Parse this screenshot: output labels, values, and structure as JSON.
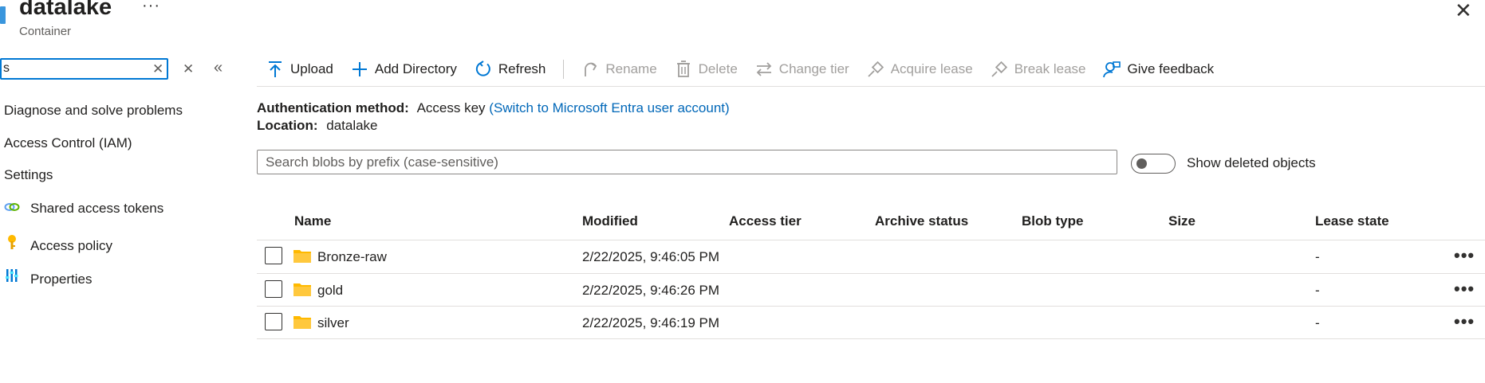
{
  "header": {
    "title": "datalake",
    "subtitle": "Container",
    "more_label": "···",
    "close_label": "✕"
  },
  "nav": {
    "search_value": "s",
    "clear_label": "✕",
    "x_label": "✕",
    "collapse_label": "«",
    "items": [
      {
        "label": "Diagnose and solve problems",
        "icon": ""
      },
      {
        "label": "Access Control (IAM)",
        "icon": ""
      },
      {
        "label": "Settings",
        "icon": ""
      },
      {
        "label": "Shared access tokens",
        "icon": "link-icon"
      },
      {
        "label": "Access policy",
        "icon": "key-icon"
      },
      {
        "label": "Properties",
        "icon": "properties-icon"
      }
    ]
  },
  "toolbar": {
    "upload": "Upload",
    "add_directory": "Add Directory",
    "refresh": "Refresh",
    "rename": "Rename",
    "delete": "Delete",
    "change_tier": "Change tier",
    "acquire_lease": "Acquire lease",
    "break_lease": "Break lease",
    "give_feedback": "Give feedback"
  },
  "info": {
    "auth_label": "Authentication method:",
    "auth_value": "Access key",
    "auth_link": "(Switch to Microsoft Entra user account)",
    "location_label": "Location:",
    "location_value": "datalake"
  },
  "blob_search": {
    "placeholder": "Search blobs by prefix (case-sensitive)",
    "value": ""
  },
  "show_deleted": {
    "label": "Show deleted objects",
    "on": false
  },
  "table": {
    "columns": [
      "Name",
      "Modified",
      "Access tier",
      "Archive status",
      "Blob type",
      "Size",
      "Lease state"
    ],
    "rows": [
      {
        "name": "Bronze-raw",
        "modified": "2/22/2025, 9:46:05 PM",
        "access_tier": "",
        "archive_status": "",
        "blob_type": "",
        "size": "",
        "lease_state": "-",
        "more": "•••"
      },
      {
        "name": "gold",
        "modified": "2/22/2025, 9:46:26 PM",
        "access_tier": "",
        "archive_status": "",
        "blob_type": "",
        "size": "",
        "lease_state": "-",
        "more": "•••"
      },
      {
        "name": "silver",
        "modified": "2/22/2025, 9:46:19 PM",
        "access_tier": "",
        "archive_status": "",
        "blob_type": "",
        "size": "",
        "lease_state": "-",
        "more": "•••"
      }
    ]
  },
  "colors": {
    "accent": "#0078d4",
    "link": "#0067b8",
    "folder": "#ffb900",
    "disabled": "#a19f9d"
  }
}
